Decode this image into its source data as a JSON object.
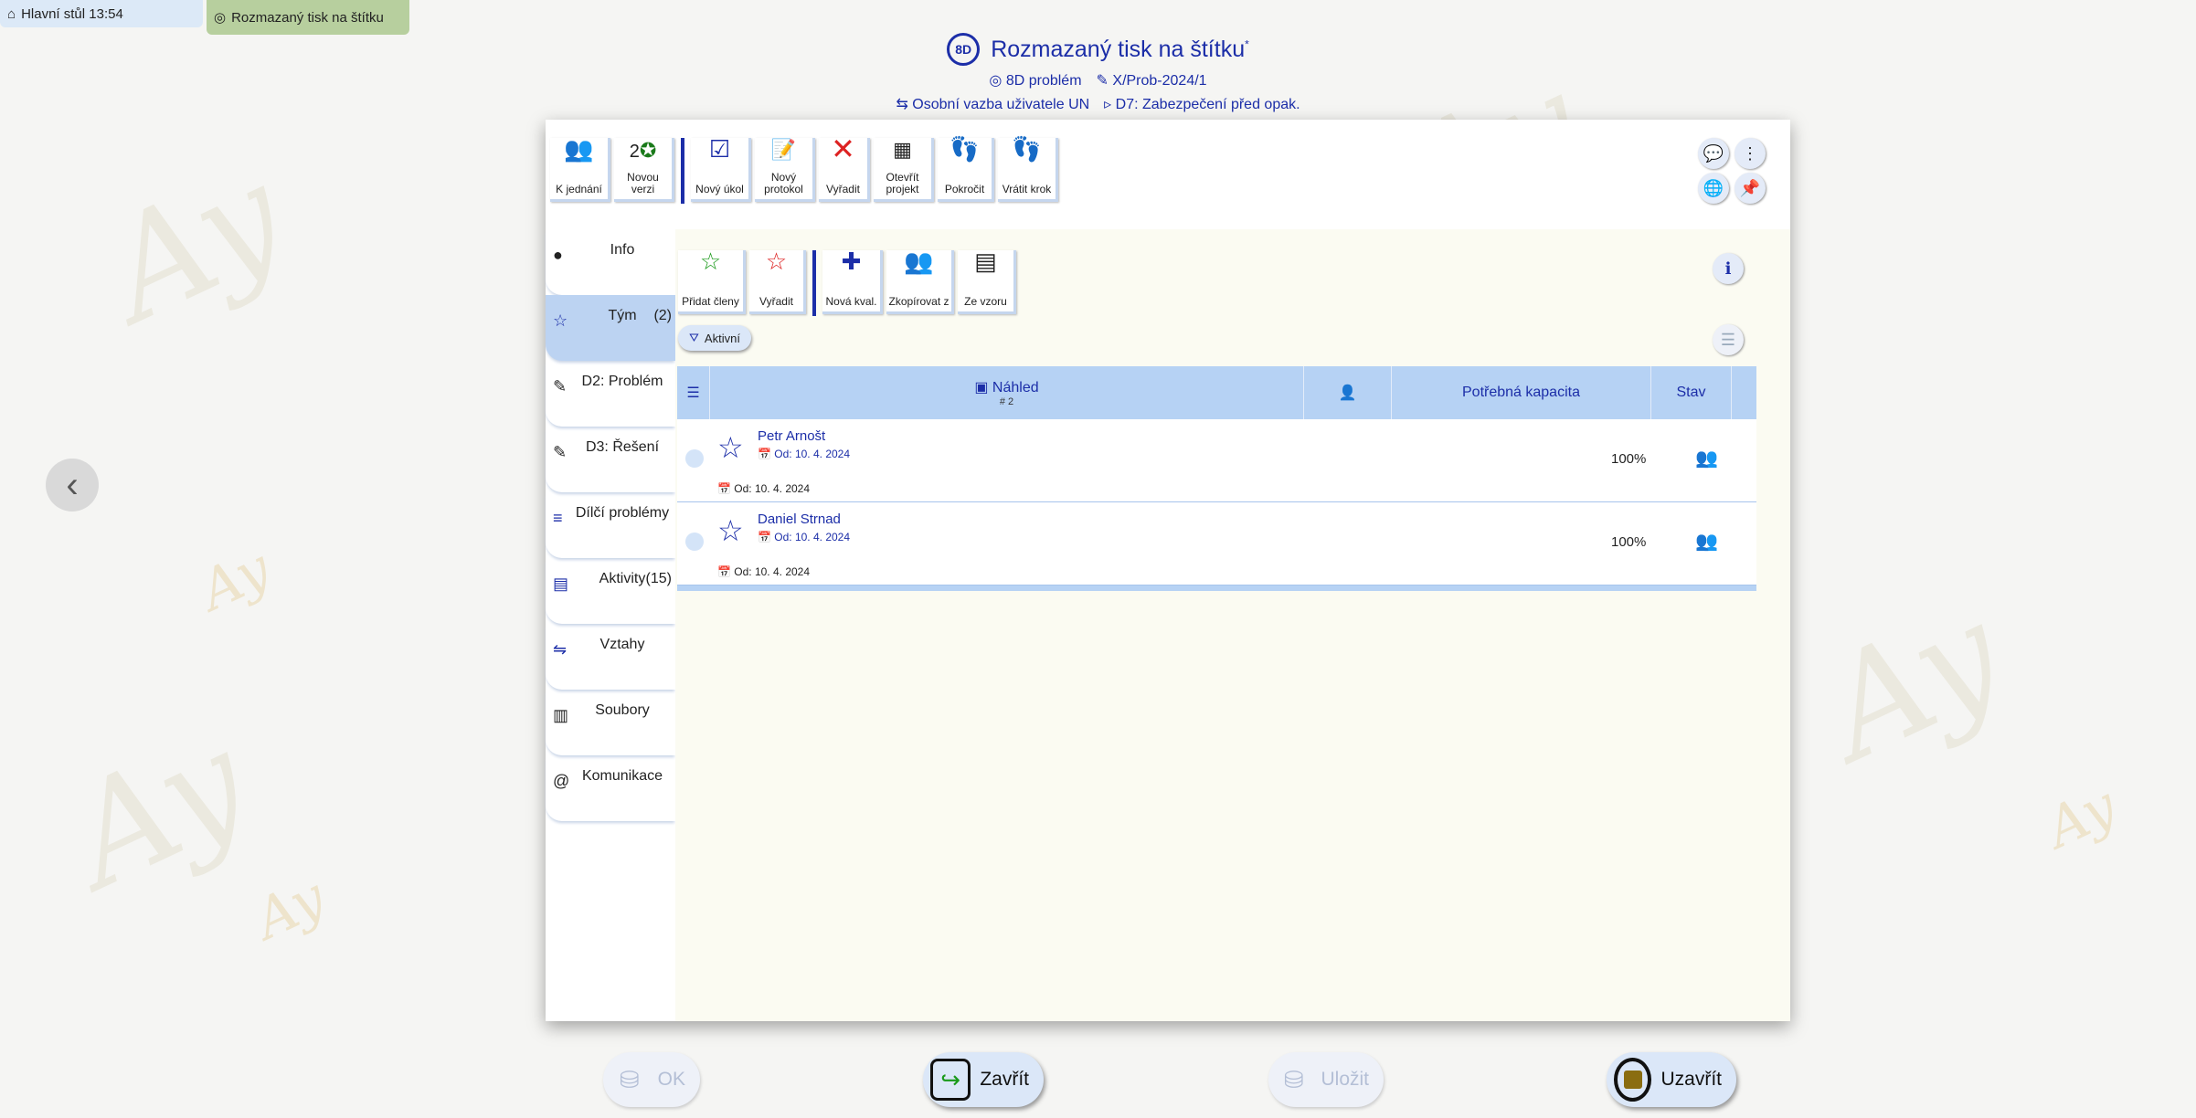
{
  "taskbar": {
    "home_tab": "Hlavní stůl 13:54",
    "doc_tab": "Rozmazaný tisk na štítku"
  },
  "header": {
    "badge": "8D",
    "title": "Rozmazaný tisk na štítku",
    "title_suffix": "*",
    "type": "8D problém",
    "code": "X/Prob-2024/1",
    "link1": "Osobní vazba uživatele UN",
    "link2": "D7: Zabezpečení před opak."
  },
  "toolbar": {
    "items": [
      {
        "label": "K jednání",
        "icon": "meeting-icon"
      },
      {
        "label": "Novou verzi",
        "icon": "new-version-icon",
        "badge": "2"
      },
      {
        "label": "Nový úkol",
        "icon": "new-task-icon"
      },
      {
        "label": "Nový protokol",
        "icon": "new-protocol-icon"
      },
      {
        "label": "Vyřadit",
        "icon": "discard-icon"
      },
      {
        "label": "Otevřít projekt",
        "icon": "open-project-icon"
      },
      {
        "label": "Pokročit",
        "icon": "advance-icon"
      },
      {
        "label": "Vrátit krok",
        "icon": "step-back-icon"
      }
    ]
  },
  "sidebar": {
    "items": [
      {
        "label": "Info",
        "count": ""
      },
      {
        "label": "Tým",
        "count": "(2)"
      },
      {
        "label": "D2: Problém",
        "count": ""
      },
      {
        "label": "D3: Řešení",
        "count": ""
      },
      {
        "label": "Dílčí problémy",
        "count": ""
      },
      {
        "label": "Aktivity",
        "count": "(15)"
      },
      {
        "label": "Vztahy",
        "count": ""
      },
      {
        "label": "Soubory",
        "count": ""
      },
      {
        "label": "Komunikace",
        "count": ""
      }
    ]
  },
  "team_toolbar": {
    "items": [
      {
        "label": "Přidat členy"
      },
      {
        "label": "Vyřadit"
      },
      {
        "label": "Nová kval."
      },
      {
        "label": "Zkopírovat z"
      },
      {
        "label": "Ze vzoru"
      }
    ],
    "filter": "Aktivní"
  },
  "table": {
    "columns": {
      "preview": "Náhled",
      "preview_count": "2",
      "capacity": "Potřebná kapacita",
      "status": "Stav"
    },
    "rows": [
      {
        "name": "Petr Arnošt",
        "from1": "Od: 10. 4. 2024",
        "from2": "Od: 10. 4. 2024",
        "capacity": "100%"
      },
      {
        "name": "Daniel Strnad",
        "from1": "Od: 10. 4. 2024",
        "from2": "Od: 10. 4. 2024",
        "capacity": "100%"
      }
    ]
  },
  "footer": {
    "ok": "OK",
    "close": "Zavřít",
    "save": "Uložit",
    "finish": "Uzavřít"
  },
  "colors": {
    "accent": "#1c2ea8",
    "header_blue": "#b6d2f4",
    "active_tab": "#b7cf9e"
  }
}
